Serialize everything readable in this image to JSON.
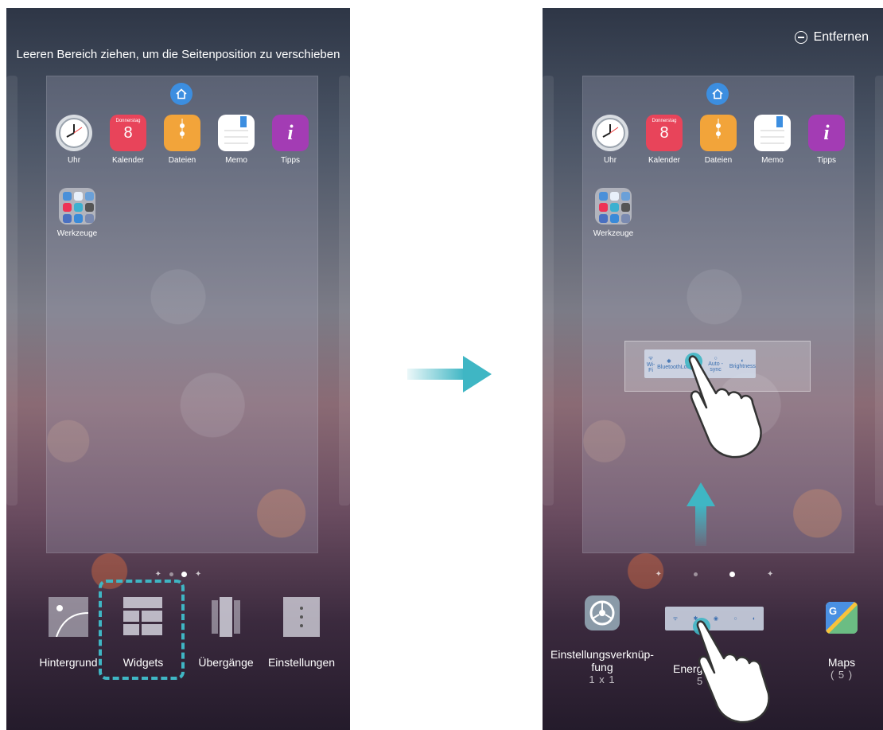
{
  "left_screen": {
    "hint": "Leeren Bereich ziehen, um die Seitenposition zu verschieben",
    "apps": [
      {
        "label": "Uhr"
      },
      {
        "label": "Kalender",
        "cal_day": "Donnerstag",
        "cal_date": "8"
      },
      {
        "label": "Dateien"
      },
      {
        "label": "Memo"
      },
      {
        "label": "Tipps"
      }
    ],
    "folder_label": "Werkzeuge",
    "menu": [
      {
        "label": "Hintergrund"
      },
      {
        "label": "Widgets"
      },
      {
        "label": "Übergänge"
      },
      {
        "label": "Einstellungen"
      }
    ]
  },
  "right_screen": {
    "remove_label": "Entfernen",
    "apps": [
      {
        "label": "Uhr"
      },
      {
        "label": "Kalender",
        "cal_day": "Donnerstag",
        "cal_date": "8"
      },
      {
        "label": "Dateien"
      },
      {
        "label": "Memo"
      },
      {
        "label": "Tipps"
      }
    ],
    "folder_label": "Werkzeuge",
    "widget_toggles": [
      "Wi-Fi",
      "Bluetooth",
      "Location",
      "Auto - sync",
      "Brightness"
    ],
    "widgets": [
      {
        "name_line1": "Einstellungsverknüp-",
        "name_line2": "fung",
        "size": "1 x 1"
      },
      {
        "name_line1": "Energiest",
        "name_line2": "",
        "size": "5"
      },
      {
        "name_line1": "Maps",
        "name_line2": "",
        "size": "( 5 )"
      }
    ]
  },
  "colors": {
    "accent": "#3fb6c4",
    "home_icon": "#3c8ee0"
  },
  "icons": [
    "home-icon",
    "clock-icon",
    "calendar-icon",
    "files-icon",
    "memo-icon",
    "tips-icon",
    "settings-icon",
    "maps-icon",
    "hand-icon",
    "arrow-right-icon",
    "arrow-up-icon",
    "remove-icon"
  ]
}
